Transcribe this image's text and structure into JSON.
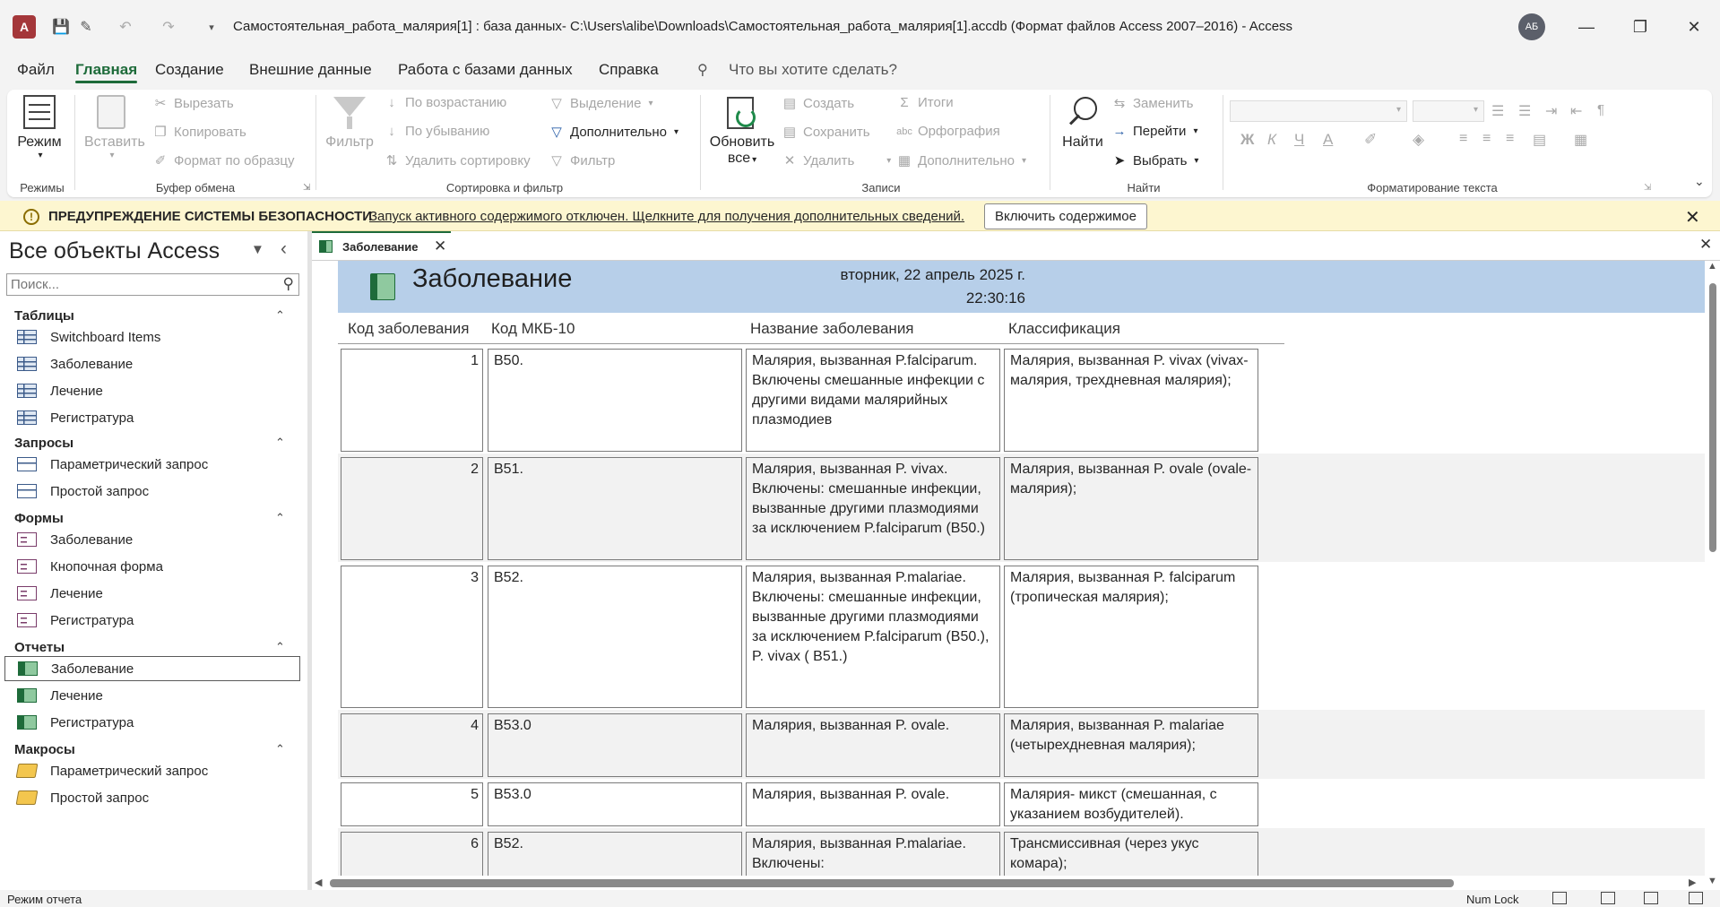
{
  "titlebar": {
    "title": "Самостоятельная_работа_малярия[1] : база данных- C:\\Users\\alibe\\Downloads\\Самостоятельная_работа_малярия[1].accdb (Формат файлов Access 2007–2016)  -  Access",
    "avatar": "АБ",
    "minimize": "—",
    "restore": "❐",
    "close": "✕"
  },
  "menu": {
    "tabs": [
      "Файл",
      "Главная",
      "Создание",
      "Внешние данные",
      "Работа с базами данных",
      "Справка"
    ],
    "search_placeholder": "Что вы хотите сделать?"
  },
  "ribbon": {
    "groups": {
      "modes": "Режимы",
      "clipboard": "Буфер обмена",
      "sortfilter": "Сортировка и фильтр",
      "records": "Записи",
      "find": "Найти",
      "textformat": "Форматирование текста"
    },
    "mode_btn": "Режим",
    "paste_btn": "Вставить",
    "cut": "Вырезать",
    "copy": "Копировать",
    "format_painter": "Формат по образцу",
    "filter_btn": "Фильтр",
    "sort_asc": "По возрастанию",
    "sort_desc": "По убыванию",
    "remove_sort": "Удалить сортировку",
    "selection": "Выделение",
    "advanced": "Дополнительно",
    "toggle_filter": "Фильтр",
    "refresh_line1": "Обновить",
    "refresh_line2": "все",
    "new": "Создать",
    "save": "Сохранить",
    "delete": "Удалить",
    "totals": "Итоги",
    "spelling": "Орфография",
    "more": "Дополнительно",
    "find_btn": "Найти",
    "replace": "Заменить",
    "goto": "Перейти",
    "select": "Выбрать"
  },
  "security": {
    "title": "ПРЕДУПРЕЖДЕНИЕ СИСТЕМЫ БЕЗОПАСНОСТИ",
    "message": "Запуск активного содержимого отключен. Щелкните для получения дополнительных сведений.",
    "button": "Включить содержимое"
  },
  "nav": {
    "title": "Все объекты Access",
    "search_placeholder": "Поиск...",
    "groups": {
      "tables": "Таблицы",
      "queries": "Запросы",
      "forms": "Формы",
      "reports": "Отчеты",
      "macros": "Макросы"
    },
    "tables": [
      "Switchboard Items",
      "Заболевание",
      "Лечение",
      "Регистратура"
    ],
    "queries": [
      "Параметрический запрос",
      "Простой запрос"
    ],
    "forms": [
      "Заболевание",
      "Кнопочная форма",
      "Лечение",
      "Регистратура"
    ],
    "reports": [
      "Заболевание",
      "Лечение",
      "Регистратура"
    ],
    "macros": [
      "Параметрический запрос",
      "Простой запрос"
    ]
  },
  "doc_tab": "Заболевание",
  "report": {
    "title": "Заболевание",
    "date": "вторник, 22 апрель 2025 г.",
    "time": "22:30:16",
    "columns": [
      "Код заболевания",
      "Код МКБ-10",
      "Название заболевания",
      "Классификация"
    ],
    "rows": [
      {
        "id": "1",
        "code": "B50.",
        "name": "Малярия, вызванная P.falciparum. Включены смешанные инфекции с другими видами малярийных плазмодиев",
        "cls": "Малярия, вызванная P. vivax (vivax-малярия, трехдневная малярия);"
      },
      {
        "id": "2",
        "code": "B51.",
        "name": "Малярия, вызванная P. vivax. Включены: смешанные инфекции, вызванные другими плазмодиями за исключением P.falciparum (B50.)",
        "cls": "Малярия, вызванная P. ovale (ovale-малярия);"
      },
      {
        "id": "3",
        "code": "B52.",
        "name": "Малярия, вызванная P.malariae. Включены: смешанные инфекции, вызванные другими плазмодиями за исключением P.falciparum (B50.), P. vivax ( B51.)",
        "cls": "Малярия, вызванная P. falciparum (тропическая малярия);"
      },
      {
        "id": "4",
        "code": "B53.0",
        "name": "Малярия, вызванная P. ovale.",
        "cls": "Малярия, вызванная P. malariae (четырехдневная малярия);"
      },
      {
        "id": "5",
        "code": "B53.0",
        "name": "Малярия, вызванная P. ovale.",
        "cls": "Малярия- микст (смешанная, с указанием возбудителей)."
      },
      {
        "id": "6",
        "code": "B52.",
        "name": "Малярия, вызванная P.malariae. Включены:",
        "cls": "Трансмиссивная (через укус комара);"
      }
    ]
  },
  "status": {
    "mode": "Режим отчета",
    "numlock": "Num Lock"
  }
}
